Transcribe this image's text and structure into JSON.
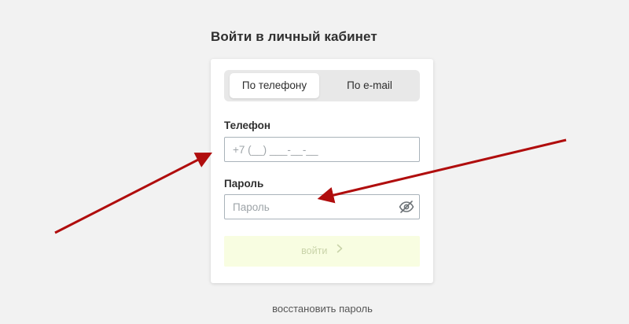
{
  "page": {
    "title": "Войти в личный кабинет"
  },
  "tabs": [
    {
      "label": "По телефону",
      "active": true
    },
    {
      "label": "По e-mail",
      "active": false
    }
  ],
  "form": {
    "phone_label": "Телефон",
    "phone_placeholder": "+7 (__) ___-__-__",
    "password_label": "Пароль",
    "password_placeholder": "Пароль",
    "password_toggle_icon": "eye-off-icon",
    "submit_label": "войти"
  },
  "links": {
    "restore_password": "восстановить пароль"
  },
  "colors": {
    "background": "#f2f2f2",
    "submit_bg": "#f8fde1",
    "submit_text": "#c9d3a9",
    "annotation_arrow": "#b00d0d"
  }
}
